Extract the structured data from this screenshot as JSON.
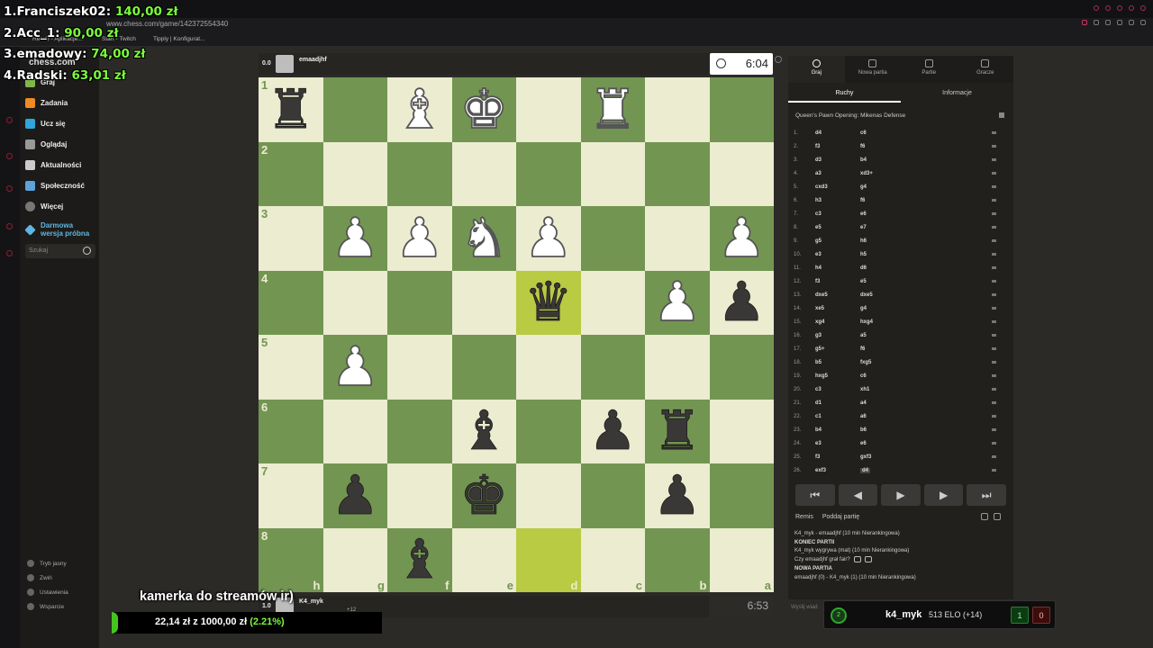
{
  "browser": {
    "url": "www.chess.com/game/142372554340",
    "bookmarks": [
      "RetuG - Aplikacje...",
      "Start - Twitch",
      "Tipply | Konfigurat..."
    ]
  },
  "donations": [
    {
      "label": "1.Franciszek02: ",
      "amount": "140,00 zł"
    },
    {
      "label": "2.Acc_1: ",
      "amount": "90,00 zł"
    },
    {
      "label": "3.emadowy: ",
      "amount": "74,00 zł"
    },
    {
      "label": "4.Radski: ",
      "amount": "63,01 zł"
    }
  ],
  "sidebar": {
    "logo": "chess.com",
    "items": [
      {
        "label": "Graj",
        "color": "#81b64c"
      },
      {
        "label": "Zadania",
        "color": "#f08a24"
      },
      {
        "label": "Ucz się",
        "color": "#2fa7d9"
      },
      {
        "label": "Oglądaj",
        "color": "#999999"
      },
      {
        "label": "Aktualności",
        "color": "#cccccc"
      },
      {
        "label": "Społeczność",
        "color": "#5da3d9"
      },
      {
        "label": "Więcej",
        "color": "#777777"
      }
    ],
    "trial_line1": "Darmowa",
    "trial_line2": "wersja próbna",
    "search_placeholder": "Szukaj",
    "bottom": [
      "Tryb jasny",
      "Zwiń",
      "Ustawienia",
      "Wsparcie"
    ]
  },
  "top_player": {
    "score": "0.0",
    "name": "emaadjhf"
  },
  "bottom_player": {
    "score": "1.0",
    "name": "K4_myk",
    "material": "+12"
  },
  "clock_top": "6:04",
  "clock_bottom": "6:53",
  "board": {
    "ranks": [
      "1",
      "2",
      "3",
      "4",
      "5",
      "6",
      "7",
      "8"
    ],
    "files": [
      "h",
      "g",
      "f",
      "e",
      "d",
      "c",
      "b",
      "a"
    ],
    "pieces": [
      {
        "sq": "0-0",
        "p": "♜",
        "c": "b"
      },
      {
        "sq": "0-2",
        "p": "♝",
        "c": "w"
      },
      {
        "sq": "0-3",
        "p": "♚",
        "c": "w"
      },
      {
        "sq": "0-5",
        "p": "♜",
        "c": "w"
      },
      {
        "sq": "2-1",
        "p": "♟",
        "c": "w"
      },
      {
        "sq": "2-2",
        "p": "♟",
        "c": "w"
      },
      {
        "sq": "2-3",
        "p": "♞",
        "c": "w"
      },
      {
        "sq": "2-4",
        "p": "♟",
        "c": "w"
      },
      {
        "sq": "2-7",
        "p": "♟",
        "c": "w"
      },
      {
        "sq": "3-4",
        "p": "♛",
        "c": "b"
      },
      {
        "sq": "3-6",
        "p": "♟",
        "c": "w"
      },
      {
        "sq": "3-7",
        "p": "♟",
        "c": "b"
      },
      {
        "sq": "4-1",
        "p": "♟",
        "c": "w"
      },
      {
        "sq": "5-3",
        "p": "♝",
        "c": "b"
      },
      {
        "sq": "5-5",
        "p": "♟",
        "c": "b"
      },
      {
        "sq": "5-6",
        "p": "♜",
        "c": "b"
      },
      {
        "sq": "6-1",
        "p": "♟",
        "c": "b"
      },
      {
        "sq": "6-3",
        "p": "♚",
        "c": "b"
      },
      {
        "sq": "6-6",
        "p": "♟",
        "c": "b"
      },
      {
        "sq": "7-2",
        "p": "♝",
        "c": "b"
      }
    ],
    "highlights": [
      "3-4",
      "7-4"
    ]
  },
  "panel": {
    "tabs": [
      "Graj",
      "Nowa partia",
      "Partie",
      "Gracze"
    ],
    "subtabs": [
      "Ruchy",
      "Informacje"
    ],
    "opening": "Queen's Pawn Opening: Mikenas Defense",
    "moves": [
      [
        "1.",
        "d4",
        "c6"
      ],
      [
        "2.",
        "f3",
        "f6"
      ],
      [
        "3.",
        "d3",
        "b4"
      ],
      [
        "4.",
        "a3",
        "xd3+"
      ],
      [
        "5.",
        "cxd3",
        "g4"
      ],
      [
        "6.",
        "h3",
        "f6"
      ],
      [
        "7.",
        "c3",
        "e6"
      ],
      [
        "8.",
        "e5",
        "e7"
      ],
      [
        "9.",
        "g5",
        "h6"
      ],
      [
        "10.",
        "e3",
        "h5"
      ],
      [
        "11.",
        "h4",
        "d6"
      ],
      [
        "12.",
        "f3",
        "e5"
      ],
      [
        "13.",
        "dxe5",
        "dxe5"
      ],
      [
        "14.",
        "xe5",
        "g4"
      ],
      [
        "15.",
        "xg4",
        "hxg4"
      ],
      [
        "16.",
        "g3",
        "a5"
      ],
      [
        "17.",
        "g5+",
        "f6"
      ],
      [
        "18.",
        "b5",
        "fxg5"
      ],
      [
        "19.",
        "hxg5",
        "c6"
      ],
      [
        "20.",
        "c3",
        "xh1"
      ],
      [
        "21.",
        "d1",
        "a4"
      ],
      [
        "22.",
        "c1",
        "a6"
      ],
      [
        "23.",
        "b4",
        "b6"
      ],
      [
        "24.",
        "e3",
        "e6"
      ],
      [
        "25.",
        "f3",
        "gxf3"
      ],
      [
        "26.",
        "exf3",
        "d4"
      ]
    ],
    "controls": [
      "⏮",
      "◀",
      "▶",
      "▶",
      "⏭"
    ],
    "actions": [
      "Remis",
      "Poddaj partię"
    ],
    "log": [
      {
        "text": "K4_myk - emaadjhf (10 min Nierankingowa)",
        "bold": false
      },
      {
        "text": "KONIEC PARTII",
        "bold": true
      },
      {
        "text": "K4_myk wygrywa (mat) (10 min Nierankingowa)",
        "bold": false
      },
      {
        "text": "Czy emaadjhf grał fair?",
        "bold": false
      },
      {
        "text": "NOWA PARTIA",
        "bold": true
      },
      {
        "text": "emaadjhf (0) - K4_myk (1) (10 min Nierankingowa)",
        "bold": false
      }
    ],
    "message_placeholder": "Wyślij wiad"
  },
  "overlay": {
    "camera_text": "kamerka do streamów ir)",
    "goal_current": "22,14 zł",
    "goal_sep": " z ",
    "goal_target": "1000,00 zł",
    "goal_pct": " (2.21%)",
    "goal_fraction": 0.0221,
    "elo_name": "k4_myk",
    "elo_value": "513 ELO (+14)",
    "wins": "1",
    "losses": "0",
    "icon_badge": "2"
  }
}
